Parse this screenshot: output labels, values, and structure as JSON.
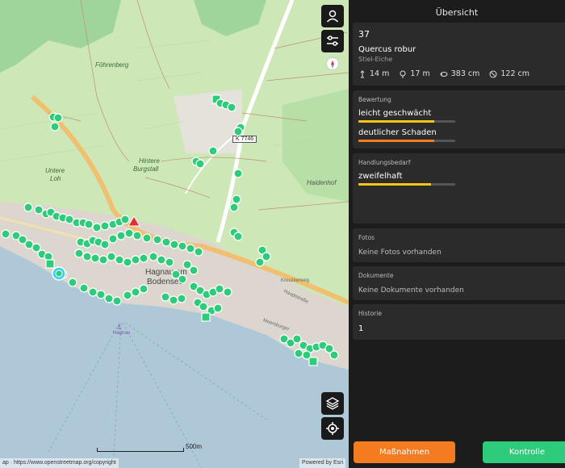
{
  "panel": {
    "title": "Übersicht",
    "tree": {
      "id": "37",
      "latin_name": "Quercus robur",
      "common_name": "Stiel-Eiche",
      "height": "14 m",
      "crown_height": "17 m",
      "circumference": "383 cm",
      "diameter": "122 cm",
      "icons": [
        "height-arrow-icon",
        "tree-icon",
        "circumference-icon",
        "diameter-icon"
      ]
    },
    "rating": {
      "header": "Bewertung",
      "items": [
        {
          "label": "leicht geschwächt",
          "level": 0.78,
          "color": "#f5c518"
        },
        {
          "label": "deutlicher Schaden",
          "level": 0.78,
          "color": "#f47c20"
        }
      ]
    },
    "need": {
      "header": "Handlungsbedarf",
      "label": "zweifelhaft",
      "level": 0.75,
      "color": "#f5c518"
    },
    "photos": {
      "header": "Fotos",
      "text": "Keine Fotos vorhanden"
    },
    "documents": {
      "header": "Dokumente",
      "text": "Keine Dokumente vorhanden"
    },
    "history": {
      "header": "Historie",
      "value": "1"
    },
    "buttons": {
      "measures": "Maßnahmen",
      "control": "Kontrolle"
    }
  },
  "map": {
    "attribution_left": "ap · https://www.openstreetmap.org/copyright",
    "attribution_right": "Powered by Esri",
    "scale_label": "500m",
    "road_badge": "K 7746",
    "labels": {
      "hagnau": "Hagnau am",
      "bodensee": "Bodensee",
      "hintere": "Hintere",
      "burgstall": "Burgstall",
      "fohrenberg": "Föhrenberg",
      "untere": "Untere",
      "loh": "Loh",
      "haidenhof": "Haidenhof",
      "hagnau_port": "Hagnau",
      "hauptstrasse": "Hauptstraße",
      "kreuzkerweg": "Kreuzkerweg",
      "meersburger": "Meersburger"
    },
    "colors": {
      "marker": "#2ecb7a",
      "water": "#aec8d8",
      "forest": "#9fd49a",
      "vineyard": "#cde8b6",
      "selected": "#3ad0f0",
      "alert": "#e03030"
    }
  }
}
